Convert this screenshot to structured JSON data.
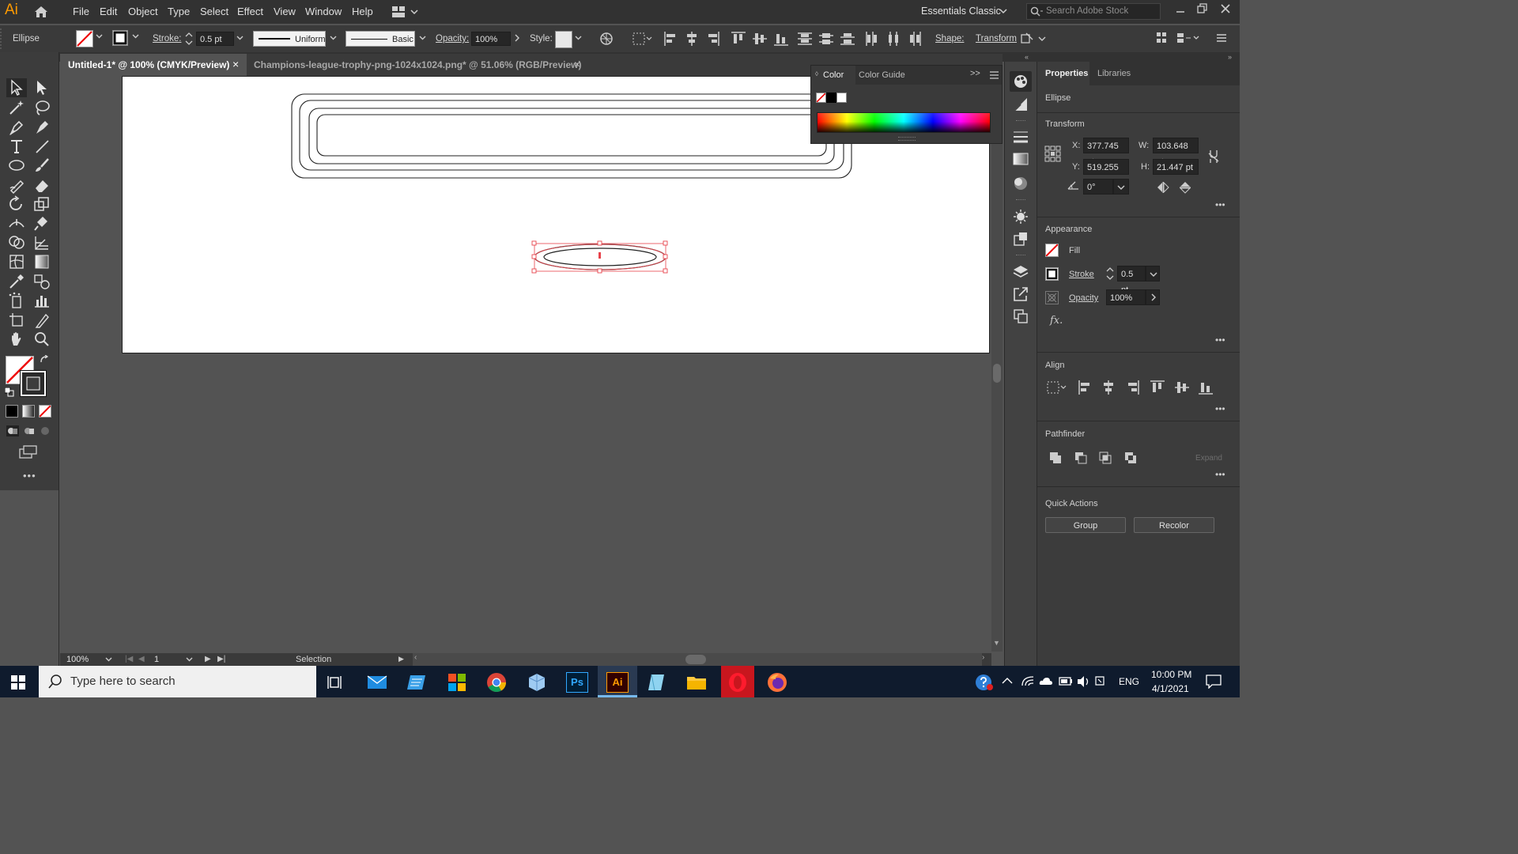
{
  "app": {
    "logo_text": "Ai"
  },
  "menu": {
    "items": [
      "File",
      "Edit",
      "Object",
      "Type",
      "Select",
      "Effect",
      "View",
      "Window",
      "Help"
    ],
    "workspace": "Essentials Classic",
    "search_placeholder": "Search Adobe Stock"
  },
  "control": {
    "object_type": "Ellipse",
    "stroke_label": "Stroke:",
    "stroke_value": "0.5 pt",
    "profile_label": "Uniform",
    "brush_label": "Basic",
    "opacity_label": "Opacity:",
    "opacity_value": "100%",
    "style_label": "Style:",
    "shape_label": "Shape:",
    "transform_label": "Transform"
  },
  "tabs": [
    {
      "label": "Untitled-1* @ 100% (CMYK/Preview)",
      "close": "×"
    },
    {
      "label": "Champions-league-trophy-png-1024x1024.png* @ 51.06% (RGB/Preview)",
      "close": "×"
    }
  ],
  "color_panel": {
    "tab_color": "Color",
    "tab_guide": "Color Guide",
    "collapse": ">>"
  },
  "properties": {
    "tab_properties": "Properties",
    "tab_libraries": "Libraries",
    "object": "Ellipse",
    "transform": {
      "title": "Transform",
      "x_label": "X:",
      "x": "377.745 pt",
      "y_label": "Y:",
      "y": "519.255 pt",
      "w_label": "W:",
      "w": "103.648 pt",
      "h_label": "H:",
      "h": "21.447 pt",
      "angle": "0°"
    },
    "appearance": {
      "title": "Appearance",
      "fill": "Fill",
      "stroke": "Stroke",
      "stroke_value": "0.5 pt",
      "opacity": "Opacity",
      "opacity_value": "100%",
      "fx": "fx."
    },
    "align": {
      "title": "Align"
    },
    "pathfinder": {
      "title": "Pathfinder",
      "expand": "Expand"
    },
    "quick_actions": {
      "title": "Quick Actions",
      "group": "Group",
      "recolor": "Recolor"
    },
    "more": "•••"
  },
  "status": {
    "zoom": "100%",
    "page": "1",
    "tool": "Selection"
  },
  "taskbar": {
    "search_placeholder": "Type here to search",
    "lang": "ENG",
    "time": "10:00 PM",
    "date": "4/1/2021",
    "ps_label": "Ps",
    "ai_label": "Ai"
  },
  "colors": {
    "accent": "#ff9a00",
    "selection": "#e8434b",
    "taskbar": "#0f1b2d"
  }
}
